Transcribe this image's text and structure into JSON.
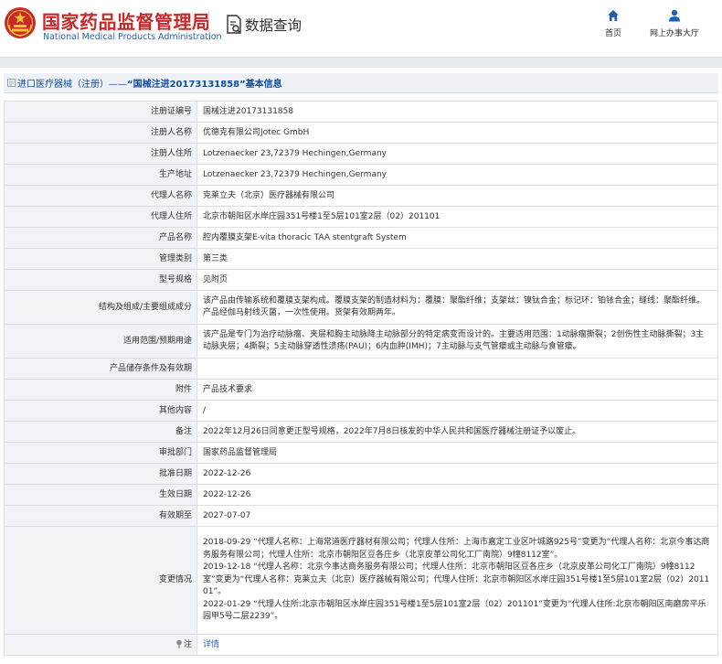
{
  "header": {
    "brand_cn": "国家药品监督管理局",
    "brand_en": "National Medical Products Administration",
    "page_title": "数据查询",
    "nav": {
      "home": "首页",
      "online_service": "网上办事大厅"
    }
  },
  "breadcrumb": {
    "prefix": "进口医疗器械（注册）——",
    "record": "“国械注进20173131858”",
    "suffix": "基本信息"
  },
  "rows": [
    {
      "label": "注册证编号",
      "value": "国械注进20173131858"
    },
    {
      "label": "注册人名称",
      "value": "优德克有限公司Jotec GmbH"
    },
    {
      "label": "注册人住所",
      "value": "Lotzenaecker 23,72379 Hechingen,Germany"
    },
    {
      "label": "生产地址",
      "value": "Lotzenaecker 23,72379 Hechingen,Germany"
    },
    {
      "label": "代理人名称",
      "value": "克莱立夫（北京）医疗器械有限公司"
    },
    {
      "label": "代理人住所",
      "value": "北京市朝阳区水岸庄园351号楼1至5层101室2层（02）201101"
    },
    {
      "label": "产品名称",
      "value": "腔内覆膜支架E-vita thoracic TAA stentgraft System"
    },
    {
      "label": "管理类别",
      "value": "第三类"
    },
    {
      "label": "型号规格",
      "value": "见附页"
    },
    {
      "label": "结构及组成/主要组成成分",
      "value": "该产品由传输系统和覆膜支架构成。覆膜支架的制造材料为：覆膜：聚酯纤维；支架丝：镍钛合金；标记环：铂铱合金；缝线：聚酯纤维。产品经伽马射线灭菌，一次性使用。货架有效期两年。"
    },
    {
      "label": "适用范围/预期用途",
      "value": "该产品是专门为治疗动脉瘤、夹层和胸主动脉降主动脉部分的特定病变而设计的。主要适用范围：1动脉瘤撕裂；2创伤性主动脉撕裂；3主动脉夹层；4撕裂；5主动脉穿透性溃疡(PAU)；6内血肿(IMH)；7主动脉与支气管瘘或主动脉与食管瘘。"
    },
    {
      "label": "产品储存条件及有效期",
      "value": ""
    },
    {
      "label": "附件",
      "value": "产品技术要求"
    },
    {
      "label": "其他内容",
      "value": "/"
    },
    {
      "label": "备注",
      "value": "2022年12月26日同意更正型号规格，2022年7月8日核发的中华人民共和国医疗器械注册证予以废止。"
    },
    {
      "label": "审批部门",
      "value": "国家药品监督管理局"
    },
    {
      "label": "批准日期",
      "value": "2022-12-26"
    },
    {
      "label": "生效日期",
      "value": "2022-12-26"
    },
    {
      "label": "有效期至",
      "value": "2027-07-07"
    }
  ],
  "changes": {
    "label": "变更情况",
    "entries": [
      "2018-09-29 “代理人名称：上海常道医疗器材有限公司；代理人住所：上海市嘉定工业区叶城路925号”变更为“代理人名称：北京今事达商务服务有限公司；代理人住所：北京市朝阳区豆各庄乡（北京皮革公司化工厂南院）9幢8112室”。",
      "2019-12-18 “代理人名称：北京今事达商务服务有限公司；代理人住所：北京市朝阳区豆各庄乡（北京皮革公司化工厂南院）9幢8112室”变更为“代理人名称：克莱立夫（北京）医疗器械有限公司；代理人住所：北京市朝阳区水岸庄园351号楼1至5层101室2层（02）201101”。",
      "2022-01-29 “代理人住所:北京市朝阳区水岸庄园351号楼1至5层101室2层（02）201101”变更为“代理人住所:北京市朝阳区南磨房平乐园甲5号二层2239”。"
    ]
  },
  "note": {
    "label": "注",
    "link": "详情"
  },
  "colors": {
    "brand_red": "#c7282a",
    "brand_blue": "#2a5ea8",
    "link_blue": "#2c64b9",
    "crumb_blue": "#114b9e",
    "label_bg": "#f1f3f6",
    "border": "#dadfe6"
  },
  "icons": [
    "emblem-logo",
    "search-document-icon",
    "home-icon",
    "user-icon",
    "document-icon",
    "pin-icon"
  ]
}
